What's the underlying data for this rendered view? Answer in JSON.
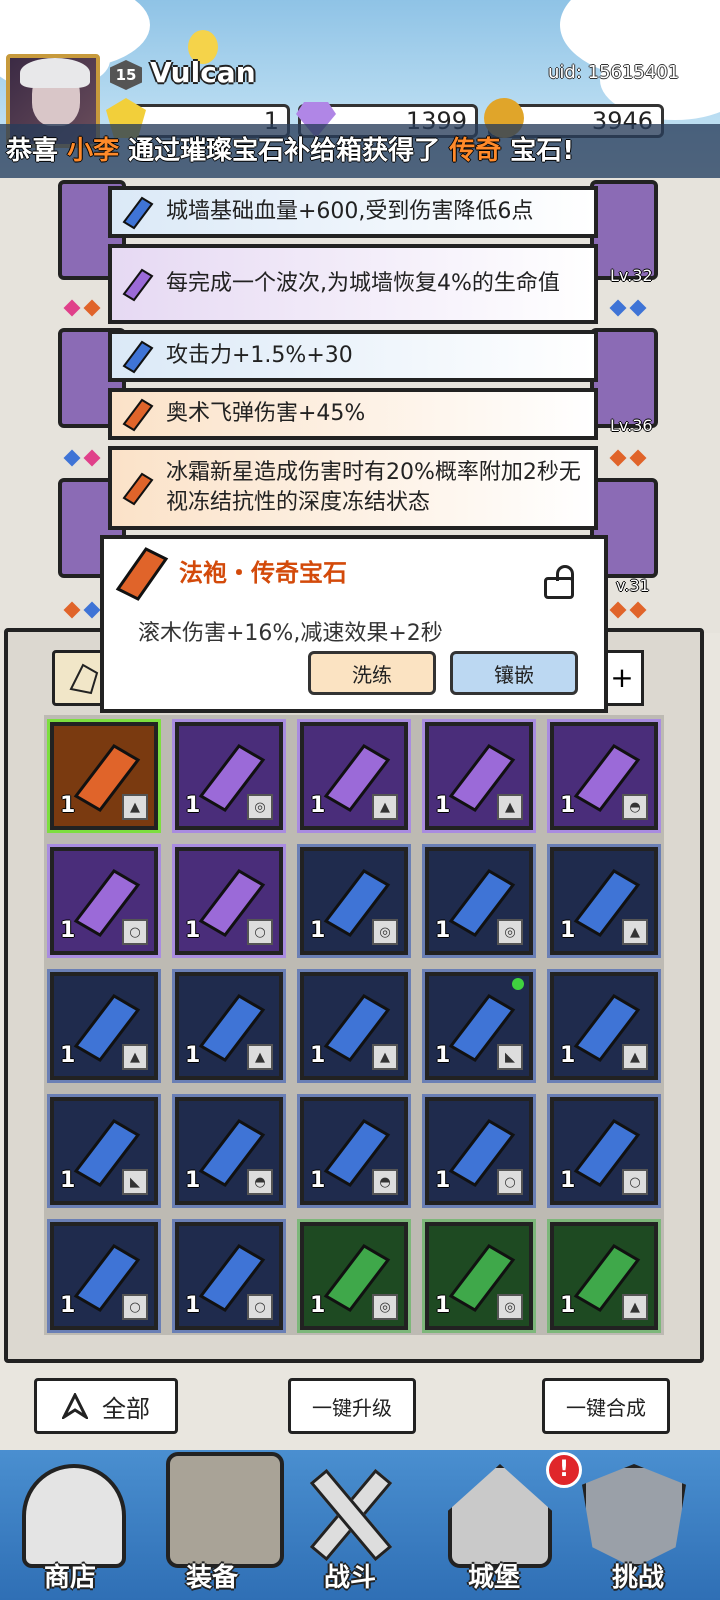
{
  "player": {
    "level": "15",
    "name": "Vulcan",
    "uid": "uid: 15615401"
  },
  "resources": [
    {
      "name": "gold-token",
      "value": "1"
    },
    {
      "name": "diamond",
      "value": "1399"
    },
    {
      "name": "coin",
      "value": "3946"
    }
  ],
  "broadcast": {
    "p1": "恭喜 ",
    "name": "小李",
    "p2": " 通过璀璨宝石补给箱获得了 ",
    "rarity": "传奇",
    "p3": " 宝石!"
  },
  "side_slots": [
    {
      "level": "Lv.32"
    },
    {
      "level": "Lv.36"
    },
    {
      "level": "v.31"
    }
  ],
  "stats": [
    {
      "text": "城墙基础血量+600,受到伤害降低6点",
      "quality": "blue"
    },
    {
      "text": "每完成一个波次,为城墙恢复4%的生命值",
      "quality": "purple"
    },
    {
      "text": "攻击力+1.5%+30",
      "quality": "blue"
    },
    {
      "text": "奥术飞弹伤害+45%",
      "quality": "orange"
    },
    {
      "text": "冰霜新星造成伤害时有20%概率附加2秒无视冻结抗性的深度冻结状态",
      "quality": "orange"
    }
  ],
  "tooltip": {
    "title": "法袍・传奇宝石",
    "desc": "滚木伤害+16%,减速效果+2秒",
    "reroll_label": "洗练",
    "inlay_label": "镶嵌"
  },
  "inventory": {
    "filter_plus": "+",
    "gems": [
      {
        "q": "1",
        "quality": "legendary",
        "color": "#e0642a",
        "slot": "robe"
      },
      {
        "q": "1",
        "quality": "epic",
        "color": "#9b6ad8",
        "slot": "ring"
      },
      {
        "q": "1",
        "quality": "epic",
        "color": "#9b6ad8",
        "slot": "robe"
      },
      {
        "q": "1",
        "quality": "epic",
        "color": "#9b6ad8",
        "slot": "robe"
      },
      {
        "q": "1",
        "quality": "epic",
        "color": "#9b6ad8",
        "slot": "hat"
      },
      {
        "q": "1",
        "quality": "epic",
        "color": "#9b6ad8",
        "slot": "necklace"
      },
      {
        "q": "1",
        "quality": "epic",
        "color": "#9b6ad8",
        "slot": "necklace"
      },
      {
        "q": "1",
        "quality": "rare",
        "color": "#3f74d6",
        "slot": "ring"
      },
      {
        "q": "1",
        "quality": "rare",
        "color": "#3f74d6",
        "slot": "ring"
      },
      {
        "q": "1",
        "quality": "rare",
        "color": "#3f74d6",
        "slot": "robe"
      },
      {
        "q": "1",
        "quality": "rare",
        "color": "#3f74d6",
        "slot": "robe"
      },
      {
        "q": "1",
        "quality": "rare",
        "color": "#3f74d6",
        "slot": "robe"
      },
      {
        "q": "1",
        "quality": "rare",
        "color": "#3f74d6",
        "slot": "robe"
      },
      {
        "q": "1",
        "quality": "rare",
        "color": "#3f74d6",
        "slot": "boots"
      },
      {
        "q": "1",
        "quality": "rare",
        "color": "#3f74d6",
        "slot": "robe"
      },
      {
        "q": "1",
        "quality": "rare",
        "color": "#3f74d6",
        "slot": "boots"
      },
      {
        "q": "1",
        "quality": "rare",
        "color": "#3f74d6",
        "slot": "hat"
      },
      {
        "q": "1",
        "quality": "rare",
        "color": "#3f74d6",
        "slot": "hat"
      },
      {
        "q": "1",
        "quality": "rare",
        "color": "#3f74d6",
        "slot": "necklace"
      },
      {
        "q": "1",
        "quality": "rare",
        "color": "#3f74d6",
        "slot": "necklace"
      },
      {
        "q": "1",
        "quality": "rare",
        "color": "#3f74d6",
        "slot": "necklace"
      },
      {
        "q": "1",
        "quality": "rare",
        "color": "#3f74d6",
        "slot": "necklace"
      },
      {
        "q": "1",
        "quality": "uncommon",
        "color": "#3fa84a",
        "slot": "ring"
      },
      {
        "q": "1",
        "quality": "uncommon",
        "color": "#3fa84a",
        "slot": "ring"
      },
      {
        "q": "1",
        "quality": "uncommon",
        "color": "#3fa84a",
        "slot": "robe"
      }
    ]
  },
  "bottom_buttons": {
    "all": "全部",
    "upgrade": "一键升级",
    "merge": "一键合成"
  },
  "nav": [
    {
      "label": "商店",
      "icon": "shop-icon"
    },
    {
      "label": "装备",
      "icon": "equipment-bag-icon"
    },
    {
      "label": "战斗",
      "icon": "crossed-swords-icon"
    },
    {
      "label": "城堡",
      "icon": "castle-icon",
      "badge": "!"
    },
    {
      "label": "挑战",
      "icon": "challenge-shield-icon"
    }
  ]
}
